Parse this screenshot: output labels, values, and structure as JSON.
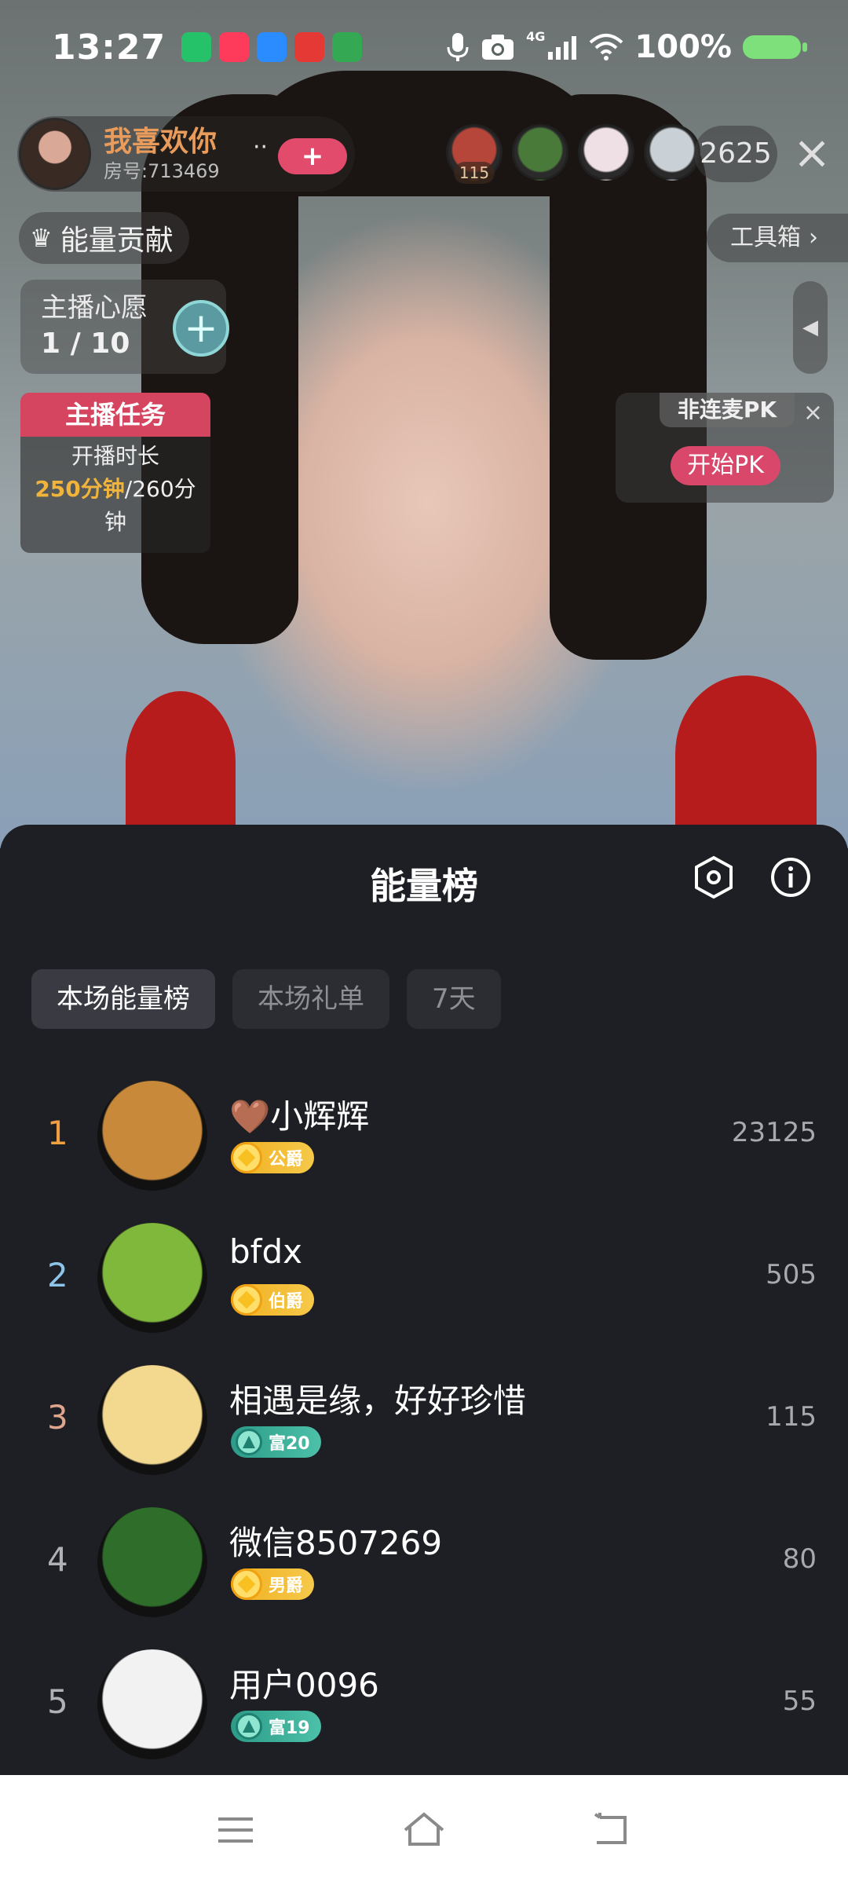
{
  "status_bar": {
    "time": "13:27",
    "network": "4G",
    "battery": "100%",
    "app_icons": [
      {
        "name": "wechat-style-app-icon",
        "color": "#25c26a"
      },
      {
        "name": "video-app-icon",
        "color": "#ff3b5c"
      },
      {
        "name": "browser-app-icon",
        "color": "#2a8cff"
      },
      {
        "name": "toutiao-app-icon",
        "color": "#e53935"
      },
      {
        "name": "play-app-icon",
        "color": "#34a853"
      }
    ]
  },
  "host": {
    "name": "我喜欢你",
    "room": "房号:713469",
    "more": "··",
    "follow_symbol": "+"
  },
  "viewers": {
    "first_badge": "115",
    "count": "2625",
    "avatars": [
      {
        "name": "viewer-avatar",
        "color": "#b7463a"
      },
      {
        "name": "viewer-avatar",
        "color": "#4a7a3a"
      },
      {
        "name": "viewer-avatar",
        "color": "#efe0e6"
      },
      {
        "name": "viewer-avatar",
        "color": "#c9d0d6"
      }
    ]
  },
  "energy_contribution": {
    "label": "能量贡献",
    "icon": "crown-icon"
  },
  "toolbox": {
    "label": "工具箱",
    "chevron": "›"
  },
  "wish": {
    "title": "主播心愿",
    "progress": "1 / 10",
    "add_symbol": "+"
  },
  "side_toggle": {
    "symbol": "◀"
  },
  "host_task": {
    "header": "主播任务",
    "line1": "开播时长",
    "current": "250分钟",
    "target": "/260分",
    "unit": "钟"
  },
  "pk": {
    "title": "非连麦PK",
    "close": "×",
    "button": "开始PK"
  },
  "close_symbol": "×",
  "sheet": {
    "title": "能量榜",
    "tabs": [
      "本场能量榜",
      "本场礼单",
      "7天"
    ],
    "active_tab": 0,
    "rank_colors": {
      "1": "#f0a040",
      "2": "#8ec4ea",
      "3": "#e0a58c",
      "other": "#b0b1b6"
    },
    "rows": [
      {
        "rank": "1",
        "name": "🤎小辉辉",
        "badge": "公爵",
        "badge_type": "gold",
        "score": "23125",
        "avatar_color": "#c88a3a"
      },
      {
        "rank": "2",
        "name": "bfdx",
        "badge": "伯爵",
        "badge_type": "gold",
        "score": "505",
        "avatar_color": "#7fb83a"
      },
      {
        "rank": "3",
        "name": "相遇是缘，好好珍惜",
        "badge": "富20",
        "badge_type": "green",
        "score": "115",
        "avatar_color": "#f3d890"
      },
      {
        "rank": "4",
        "name": "微信8507269",
        "badge": "男爵",
        "badge_type": "gold",
        "score": "80",
        "avatar_color": "#2f6e2a"
      },
      {
        "rank": "5",
        "name": "用户0096",
        "badge": "富19",
        "badge_type": "green",
        "score": "55",
        "avatar_color": "#f2f2f2"
      }
    ]
  }
}
